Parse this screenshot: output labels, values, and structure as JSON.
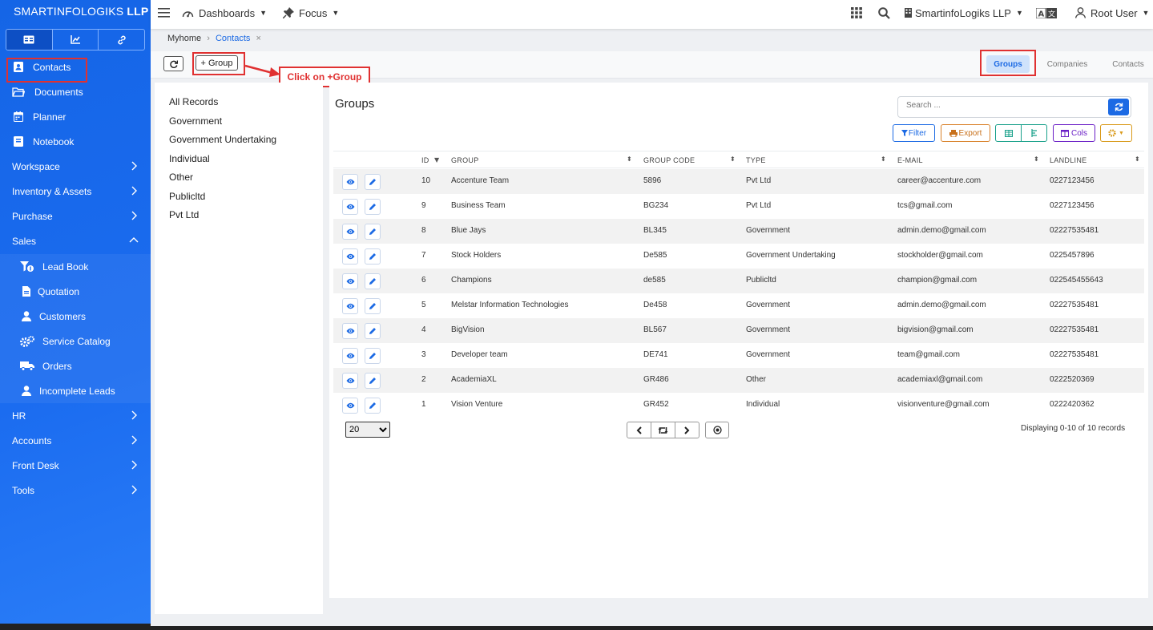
{
  "brand": {
    "name": "SMARTINFOLOGIKS",
    "suffix": "LLP"
  },
  "sidebar": {
    "tabs": [
      {
        "icon": "card-icon"
      },
      {
        "icon": "chart-icon"
      },
      {
        "icon": "link-icon"
      }
    ],
    "items": [
      {
        "label": "Contacts",
        "icon": "contact-book-icon"
      },
      {
        "label": "Documents",
        "icon": "folder-icon"
      },
      {
        "label": "Planner",
        "icon": "calendar-icon"
      },
      {
        "label": "Notebook",
        "icon": "notebook-icon"
      },
      {
        "label": "Workspace"
      },
      {
        "label": "Inventory & Assets"
      },
      {
        "label": "Purchase"
      },
      {
        "label": "Sales"
      },
      {
        "label": "Lead Book",
        "icon": "funnel-icon"
      },
      {
        "label": "Quotation",
        "icon": "file-icon"
      },
      {
        "label": "Customers",
        "icon": "user-icon"
      },
      {
        "label": "Service Catalog",
        "icon": "gears-icon"
      },
      {
        "label": "Orders",
        "icon": "truck-icon"
      },
      {
        "label": "Incomplete Leads",
        "icon": "user-icon"
      },
      {
        "label": "HR"
      },
      {
        "label": "Accounts"
      },
      {
        "label": "Front Desk"
      },
      {
        "label": "Tools"
      }
    ]
  },
  "topbar": {
    "dashboards": "Dashboards",
    "focus": "Focus",
    "company": "SmartinfoLogiks LLP",
    "user": "Root User"
  },
  "breadcrumb": {
    "home": "Myhome",
    "current": "Contacts"
  },
  "actionbar": {
    "add_group": "+ Group",
    "callout": "Click on +Group",
    "tabs": [
      "Groups",
      "Companies",
      "Contacts"
    ]
  },
  "categories": [
    "All Records",
    "Government",
    "Government Undertaking",
    "Individual",
    "Other",
    "Publicltd",
    "Pvt Ltd"
  ],
  "main": {
    "title": "Groups",
    "search_placeholder": "Search ...",
    "filter": "Filter",
    "export": "Export",
    "cols": "Cols"
  },
  "table": {
    "headers": [
      "ID",
      "GROUP",
      "GROUP CODE",
      "TYPE",
      "E-MAIL",
      "LANDLINE"
    ],
    "rows": [
      [
        "10",
        "Accenture Team",
        "5896",
        "Pvt Ltd",
        "career@accenture.com",
        "0227123456"
      ],
      [
        "9",
        "Business Team",
        "BG234",
        "Pvt Ltd",
        "tcs@gmail.com",
        "0227123456"
      ],
      [
        "8",
        "Blue Jays",
        "BL345",
        "Government",
        "admin.demo@gmail.com",
        "02227535481"
      ],
      [
        "7",
        "Stock Holders",
        "De585",
        "Government Undertaking",
        "stockholder@gmail.com",
        "0225457896"
      ],
      [
        "6",
        "Champions",
        "de585",
        "Publicltd",
        "champion@gmail.com",
        "022545455643"
      ],
      [
        "5",
        "Melstar Information Technologies",
        "De458",
        "Government",
        "admin.demo@gmail.com",
        "02227535481"
      ],
      [
        "4",
        "BigVision",
        "BL567",
        "Government",
        "bigvision@gmail.com",
        "02227535481"
      ],
      [
        "3",
        "Developer team",
        "DE741",
        "Government",
        "team@gmail.com",
        "02227535481"
      ],
      [
        "2",
        "AcademiaXL",
        "GR486",
        "Other",
        "academiaxl@gmail.com",
        "0222520369"
      ],
      [
        "1",
        "Vision Venture",
        "GR452",
        "Individual",
        "visionventure@gmail.com",
        "0222420362"
      ]
    ]
  },
  "footer": {
    "page_size": "20",
    "records": "Displaying 0-10 of 10 records"
  },
  "colors": {
    "accent": "#1c6ae4",
    "highlight": "#e03131",
    "sidebar": "#1b6cf0"
  }
}
